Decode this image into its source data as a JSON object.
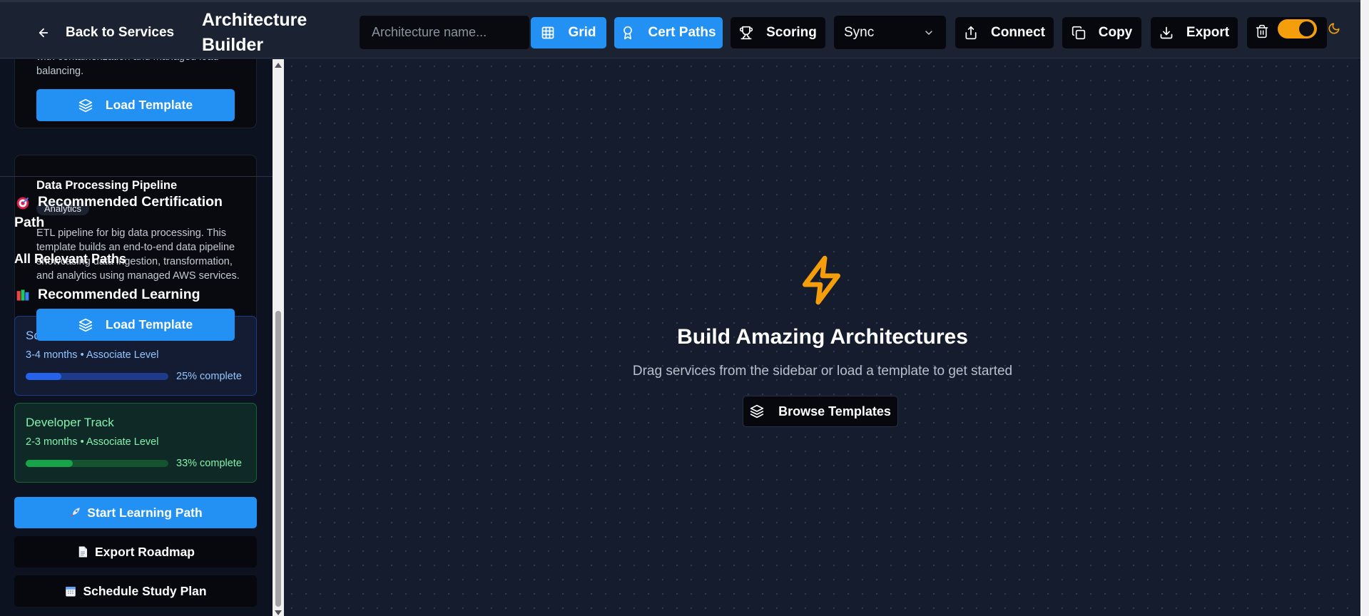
{
  "header": {
    "back_label": "Back to Services",
    "title": "Architecture Builder",
    "name_placeholder": "Architecture name...",
    "buttons": {
      "grid": "Grid",
      "cert_paths": "Cert Paths",
      "scoring": "Scoring",
      "connect": "Connect",
      "copy": "Copy",
      "export": "Export"
    },
    "sync_selected": "Sync",
    "theme_toggle_on": true
  },
  "sidebar": {
    "partial_card": {
      "description": "with containerization and managed load balancing.",
      "load_label": "Load Template"
    },
    "pipeline_card": {
      "title": "Data Processing Pipeline",
      "badge": "Analytics",
      "description": "ETL pipeline for big data processing. This template builds an end-to-end data pipeline showcasing data ingestion, transformation, and analytics using managed AWS services.",
      "load_label": "Load Template"
    },
    "cert": {
      "recommended_heading_line1": "Recommended Certification",
      "recommended_heading_line2": "Path",
      "all_paths_heading": "All Relevant Paths",
      "learning_heading": "Recommended Learning",
      "tracks": [
        {
          "name": "Solutions Architect Track",
          "meta": "3-4 months • Associate Level",
          "progress": 25,
          "progress_label": "25% complete",
          "color": "#2563eb"
        },
        {
          "name": "Developer Track",
          "meta": "2-3 months • Associate Level",
          "progress": 33,
          "progress_label": "33% complete",
          "color": "#16a34a"
        }
      ],
      "actions": {
        "start": "Start Learning Path",
        "export": "Export Roadmap",
        "schedule": "Schedule Study Plan"
      }
    }
  },
  "canvas": {
    "empty_title": "Build Amazing Architectures",
    "empty_subtitle": "Drag services from the sidebar or load a template to get started",
    "browse_label": "Browse Templates"
  },
  "colors": {
    "accent": "#2391f3",
    "bolt": "#f59e0b",
    "toggle": "#f59e0b"
  }
}
